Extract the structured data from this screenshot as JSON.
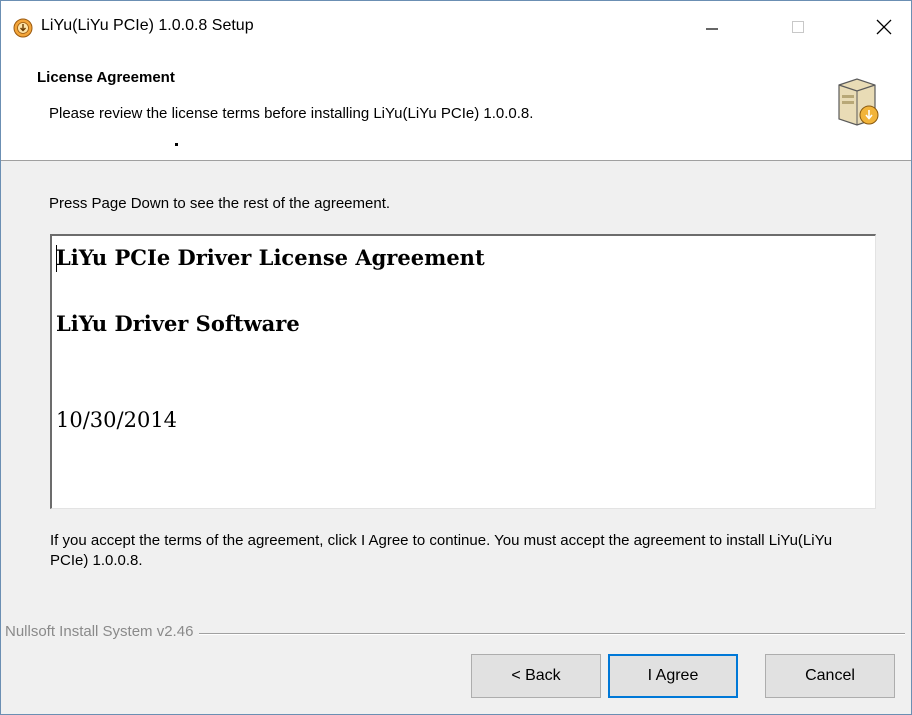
{
  "window": {
    "title": "LiYu(LiYu PCIe) 1.0.0.8 Setup",
    "accent_color": "#0078d7"
  },
  "header": {
    "title": "License Agreement",
    "subtitle": "Please review the license terms before installing LiYu(LiYu PCIe) 1.0.0.8.",
    "icon": "installer-box-icon"
  },
  "body": {
    "instruction": "Press Page Down to see the rest of the agreement.",
    "license_lines": [
      "LiYu PCIe Driver License Agreement",
      "LiYu Driver Software",
      "10/30/2014"
    ],
    "accept_text": "If you accept the terms of the agreement, click I Agree to continue. You must accept the agreement to install LiYu(LiYu PCIe) 1.0.0.8."
  },
  "footer": {
    "branding": "Nullsoft Install System v2.46",
    "buttons": {
      "back": "< Back",
      "agree": "I Agree",
      "cancel": "Cancel"
    }
  }
}
